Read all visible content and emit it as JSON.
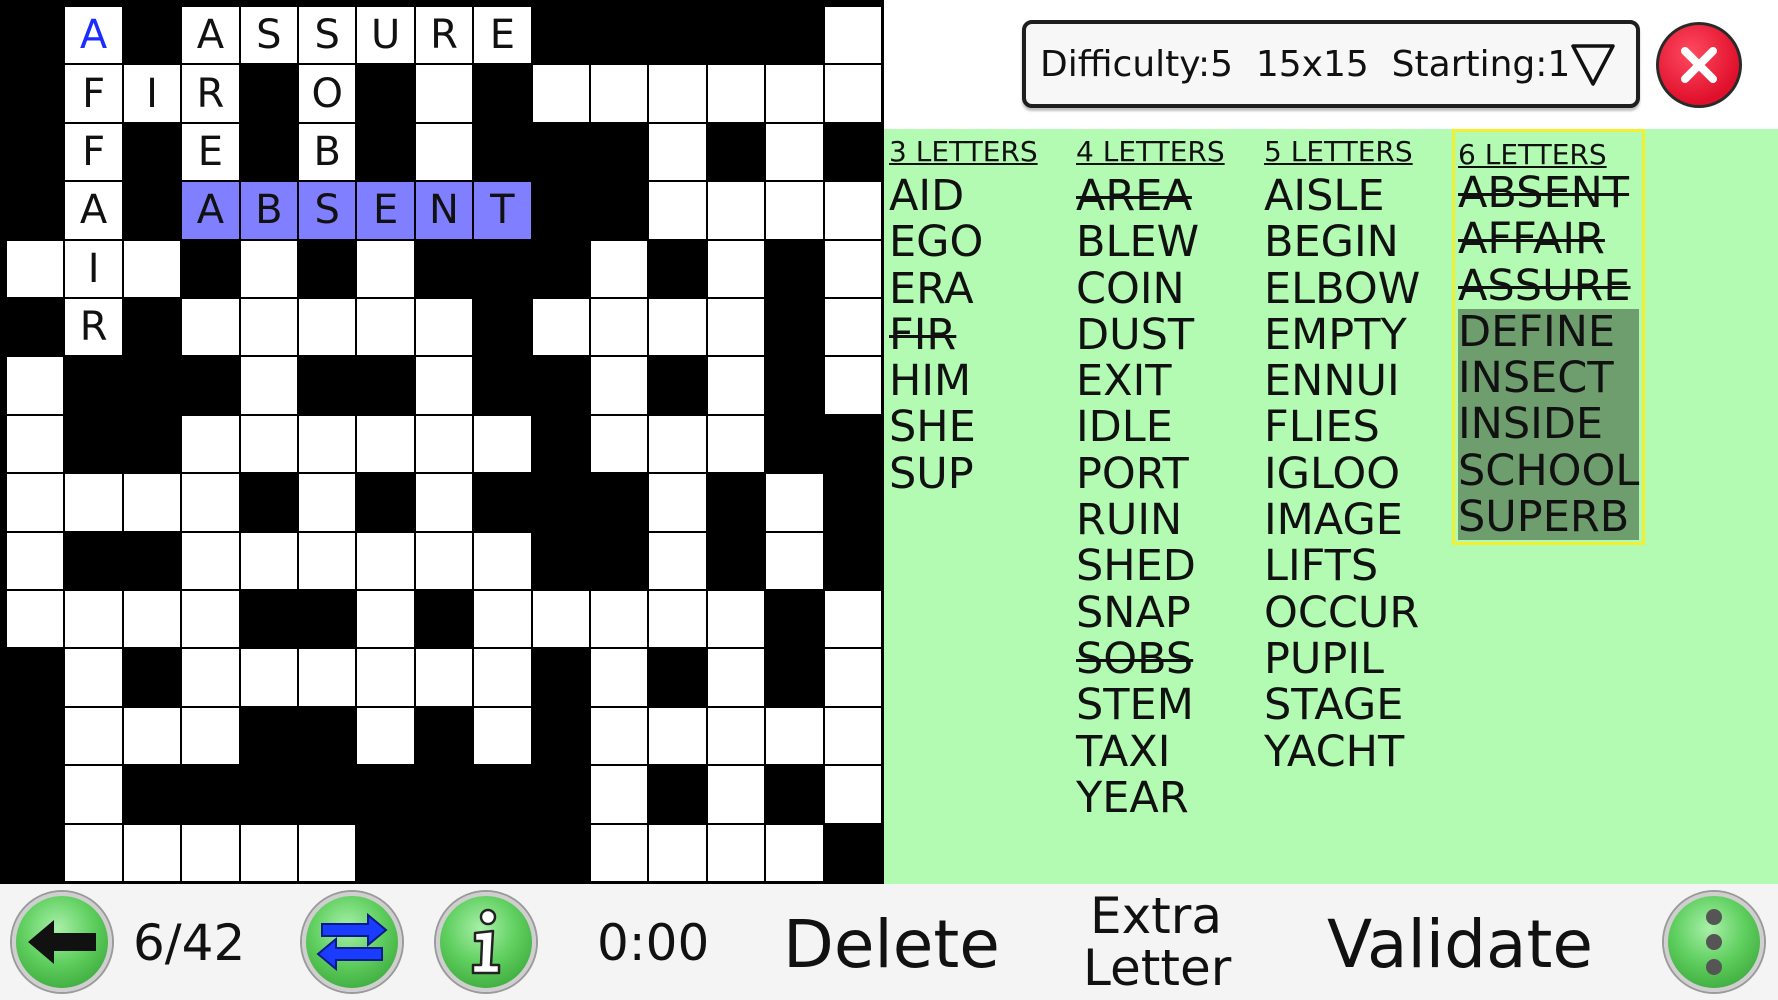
{
  "grid": {
    "size": 15,
    "rows": [
      ".A.ASSURE.....W",
      ".FIR.O.W.WWWWWW",
      ".F.E.B.W...W.W.",
      ".A.ABSENT..WWWW",
      "WIW.W.W...W.W.W",
      ".R.WWWWW.WWWW.W",
      "W...W..W..W.W.W",
      "W..WWWWWW.WWW..",
      "WWWW.W.W...W.W.",
      "W..WWWWWW..W.W.",
      "WWWW..W.WWWWW.W",
      ".W.WWWWWW.W.W.W",
      ".WWW..W.W.WWWWW",
      ".W........W.W.W",
      ".WWWWW....WWWW."
    ],
    "highlight": [
      [
        3,
        3
      ],
      [
        3,
        4
      ],
      [
        3,
        5
      ],
      [
        3,
        6
      ],
      [
        3,
        7
      ],
      [
        3,
        8
      ]
    ],
    "cursor": [
      0,
      1
    ],
    "highlight_color": "#7f7fff",
    "cursor_color": "#1a2cff"
  },
  "difficulty_selector": {
    "text": "Difficulty:5  15x15  Starting:1",
    "icon": "triangle-down-icon"
  },
  "close_button": {
    "icon": "close-x-icon",
    "color": "#e0102c"
  },
  "word_list": {
    "panel_color": "#b3fbb3",
    "columns": [
      {
        "header": "3 LETTERS",
        "words": [
          {
            "text": "AID",
            "found": false
          },
          {
            "text": "EGO",
            "found": false
          },
          {
            "text": "ERA",
            "found": false
          },
          {
            "text": "FIR",
            "found": true
          },
          {
            "text": "HIM",
            "found": false
          },
          {
            "text": "SHE",
            "found": false
          },
          {
            "text": "SUP",
            "found": false
          }
        ]
      },
      {
        "header": "4 LETTERS",
        "words": [
          {
            "text": "AREA",
            "found": true
          },
          {
            "text": "BLEW",
            "found": false
          },
          {
            "text": "COIN",
            "found": false
          },
          {
            "text": "DUST",
            "found": false
          },
          {
            "text": "EXIT",
            "found": false
          },
          {
            "text": "IDLE",
            "found": false
          },
          {
            "text": "PORT",
            "found": false
          },
          {
            "text": "RUIN",
            "found": false
          },
          {
            "text": "SHED",
            "found": false
          },
          {
            "text": "SNAP",
            "found": false
          },
          {
            "text": "SOBS",
            "found": true
          },
          {
            "text": "STEM",
            "found": false
          },
          {
            "text": "TAXI",
            "found": false
          },
          {
            "text": "YEAR",
            "found": false
          }
        ]
      },
      {
        "header": "5 LETTERS",
        "words": [
          {
            "text": "AISLE",
            "found": false
          },
          {
            "text": "BEGIN",
            "found": false
          },
          {
            "text": "ELBOW",
            "found": false
          },
          {
            "text": "EMPTY",
            "found": false
          },
          {
            "text": "ENNUI",
            "found": false
          },
          {
            "text": "FLIES",
            "found": false
          },
          {
            "text": "IGLOO",
            "found": false
          },
          {
            "text": "IMAGE",
            "found": false
          },
          {
            "text": "LIFTS",
            "found": false
          },
          {
            "text": "OCCUR",
            "found": false
          },
          {
            "text": "PUPIL",
            "found": false
          },
          {
            "text": "STAGE",
            "found": false
          },
          {
            "text": "YACHT",
            "found": false
          }
        ]
      },
      {
        "header": "6 LETTERS",
        "words": [
          {
            "text": "ABSENT",
            "found": true
          },
          {
            "text": "AFFAIR",
            "found": true
          },
          {
            "text": "ASSURE",
            "found": true
          },
          {
            "text": "DEFINE",
            "found": false
          },
          {
            "text": "INSECT",
            "found": false
          },
          {
            "text": "INSIDE",
            "found": false
          },
          {
            "text": "SCHOOL",
            "found": false
          },
          {
            "text": "SUPERB",
            "found": false
          }
        ]
      }
    ]
  },
  "toolbar": {
    "back_icon": "arrow-left-icon",
    "progress": "6/42",
    "swap_icon": "swap-arrows-icon",
    "info_icon": "info-icon",
    "timer": "0:00",
    "delete_label": "Delete",
    "extra_letter_line1": "Extra",
    "extra_letter_line2": "Letter",
    "validate_label": "Validate",
    "menu_icon": "more-vertical-icon"
  }
}
